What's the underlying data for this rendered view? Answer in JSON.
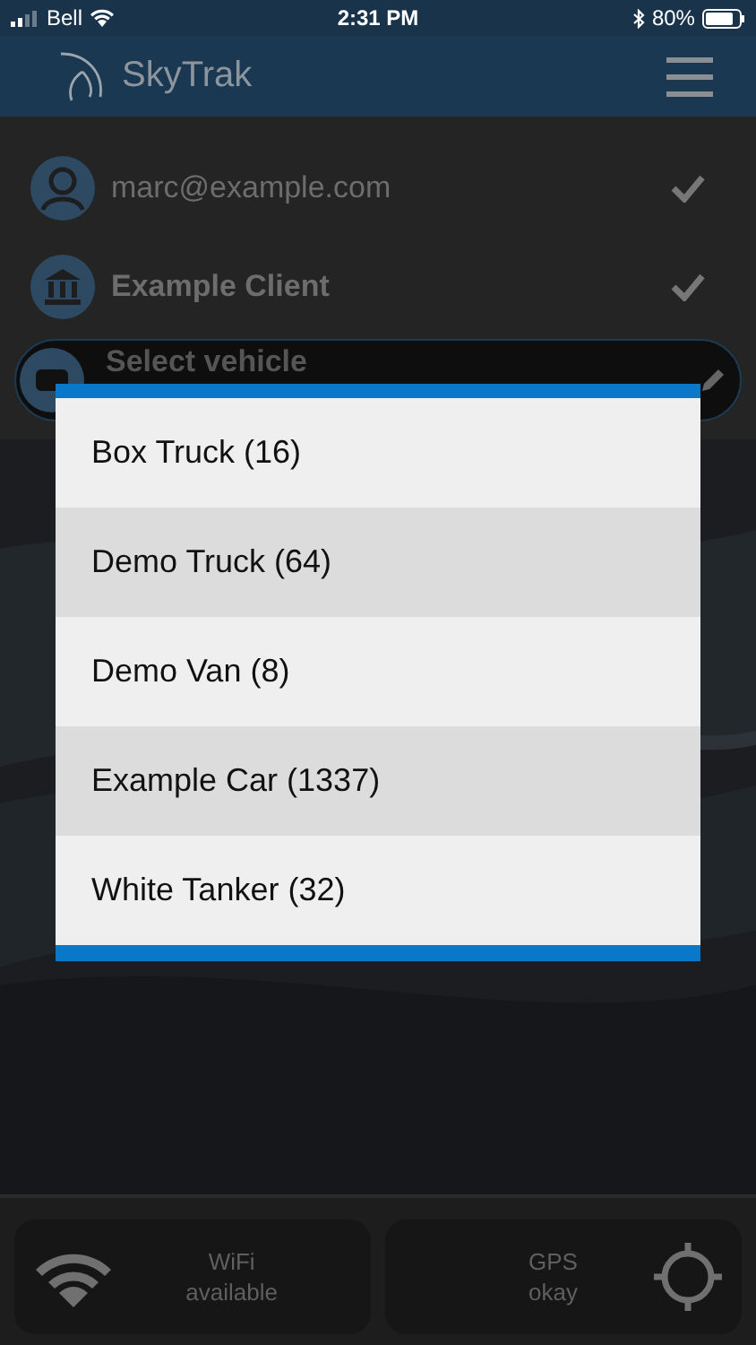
{
  "status_bar": {
    "carrier": "Bell",
    "time": "2:31 PM",
    "battery": "80%"
  },
  "header": {
    "title": "SkyTrak"
  },
  "rows": [
    {
      "kind": "user",
      "label": "marc@example.com",
      "bold": false,
      "checked": true
    },
    {
      "kind": "client",
      "label": "Example Client",
      "bold": true,
      "checked": true
    }
  ],
  "vehicle_field": {
    "placeholder": "Select vehicle"
  },
  "picker": {
    "items": [
      {
        "label": "Box Truck (16)"
      },
      {
        "label": "Demo Truck (64)"
      },
      {
        "label": "Demo Van (8)"
      },
      {
        "label": "Example Car (1337)"
      },
      {
        "label": "White Tanker (32)"
      }
    ]
  },
  "footer": [
    {
      "kind": "wifi",
      "line_1": "WiFi",
      "line_2": "available"
    },
    {
      "kind": "gps",
      "line_1": "GPS",
      "line_2": "okay"
    }
  ]
}
